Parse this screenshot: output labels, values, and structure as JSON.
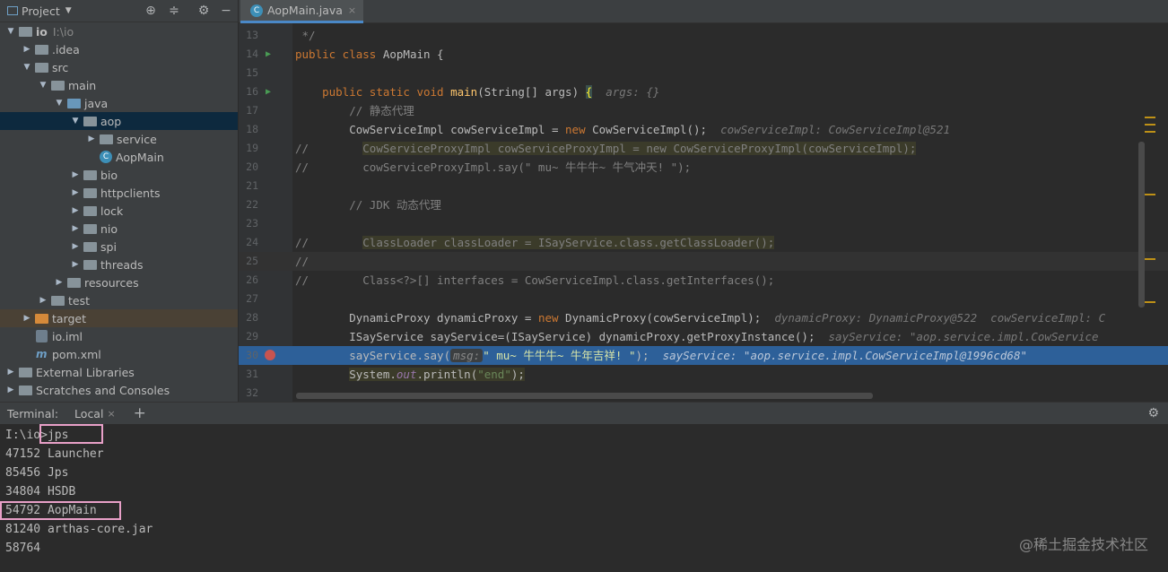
{
  "project_panel": {
    "title": "Project",
    "tree": [
      {
        "label": "io",
        "extra": "I:\\io",
        "depth": 0,
        "arrow": "▼",
        "icon": "module"
      },
      {
        "label": ".idea",
        "depth": 1,
        "arrow": "▶",
        "icon": "folder"
      },
      {
        "label": "src",
        "depth": 1,
        "arrow": "▼",
        "icon": "folder"
      },
      {
        "label": "main",
        "depth": 2,
        "arrow": "▼",
        "icon": "folder"
      },
      {
        "label": "java",
        "depth": 3,
        "arrow": "▼",
        "icon": "folder-blue"
      },
      {
        "label": "aop",
        "depth": 4,
        "arrow": "▼",
        "icon": "package",
        "selected": true
      },
      {
        "label": "service",
        "depth": 5,
        "arrow": "▶",
        "icon": "package"
      },
      {
        "label": "AopMain",
        "depth": 5,
        "arrow": "",
        "icon": "class"
      },
      {
        "label": "bio",
        "depth": 4,
        "arrow": "▶",
        "icon": "package"
      },
      {
        "label": "httpclients",
        "depth": 4,
        "arrow": "▶",
        "icon": "package"
      },
      {
        "label": "lock",
        "depth": 4,
        "arrow": "▶",
        "icon": "package"
      },
      {
        "label": "nio",
        "depth": 4,
        "arrow": "▶",
        "icon": "package"
      },
      {
        "label": "spi",
        "depth": 4,
        "arrow": "▶",
        "icon": "package"
      },
      {
        "label": "threads",
        "depth": 4,
        "arrow": "▶",
        "icon": "package"
      },
      {
        "label": "resources",
        "depth": 3,
        "arrow": "▶",
        "icon": "resources"
      },
      {
        "label": "test",
        "depth": 2,
        "arrow": "▶",
        "icon": "folder"
      },
      {
        "label": "target",
        "depth": 1,
        "arrow": "▶",
        "icon": "folder-orange",
        "excluded": true
      },
      {
        "label": "io.iml",
        "depth": 1,
        "arrow": "",
        "icon": "iml"
      },
      {
        "label": "pom.xml",
        "depth": 1,
        "arrow": "",
        "icon": "maven"
      },
      {
        "label": "External Libraries",
        "depth": 0,
        "arrow": "▶",
        "icon": "libraries"
      },
      {
        "label": "Scratches and Consoles",
        "depth": 0,
        "arrow": "▶",
        "icon": "scratches"
      }
    ]
  },
  "editor": {
    "tab_label": "AopMain.java",
    "lines": [
      {
        "n": "13",
        "html": "<span class='cm'> */</span>"
      },
      {
        "n": "14",
        "html": "<span class='kw'>public class</span> AopMain {",
        "run": true
      },
      {
        "n": "15",
        "html": ""
      },
      {
        "n": "16",
        "html": "    <span class='kw'>public static void</span> <span class='fn'>main</span>(String[] args) <span style='background:#3b514d;color:#ffef28'>{</span>  <span class='hint'>args: {}</span>",
        "run": true
      },
      {
        "n": "17",
        "html": "        <span class='cm'>// 静态代理</span>"
      },
      {
        "n": "18",
        "html": "        CowServiceImpl cowServiceImpl = <span class='kw'>new</span> CowServiceImpl();  <span class='hint'>cowServiceImpl: CowServiceImpl@521</span>"
      },
      {
        "n": "19",
        "html": "<span class='cm'>//        <span class='hl'>CowServiceProxyImpl cowServiceProxyImpl = new CowServiceProxyImpl(cowServiceImpl);</span></span>"
      },
      {
        "n": "20",
        "html": "<span class='cm'>//        cowServiceProxyImpl.say(\" mu~ 牛牛牛~ 牛气冲天! \");</span>"
      },
      {
        "n": "21",
        "html": ""
      },
      {
        "n": "22",
        "html": "        <span class='cm'>// JDK 动态代理</span>"
      },
      {
        "n": "23",
        "html": ""
      },
      {
        "n": "24",
        "html": "<span class='cm'>//        <span class='hl'>ClassLoader classLoader = ISayService.class.getClassLoader();</span></span>"
      },
      {
        "n": "25",
        "html": "<span class='cm'>//</span>",
        "current": true
      },
      {
        "n": "26",
        "html": "<span class='cm'>//        Class&lt;?&gt;[] interfaces = CowServiceImpl.class.getInterfaces();</span>"
      },
      {
        "n": "27",
        "html": ""
      },
      {
        "n": "28",
        "html": "        DynamicProxy dynamicProxy = <span class='kw'>new</span> DynamicProxy(cowServiceImpl);  <span class='hint'>dynamicProxy: DynamicProxy@522  cowServiceImpl: C</span>"
      },
      {
        "n": "29",
        "html": "        ISayService sayService=(ISayService) dynamicProxy.getProxyInstance();  <span class='hint'>sayService: \"aop.service.impl.CowService</span>"
      },
      {
        "n": "30",
        "html": "        sayService.say(<span class='hint-box'>msg:</span><span class='st' style='color:#d7e4a8'>\" mu~ 牛牛牛~ 牛年吉祥! \"</span>);  <span class='hint'>sayService: \"aop.service.impl.CowServiceImpl@1996cd68\"</span>",
        "exec": true,
        "bp": true
      },
      {
        "n": "31",
        "html": "        <span class='hl'>System.<span class='sc'>out</span>.println(<span class='st'>\"end\"</span>);</span>"
      },
      {
        "n": "32",
        "html": ""
      }
    ]
  },
  "terminal": {
    "label": "Terminal:",
    "tab": "Local",
    "lines": [
      "I:\\io>jps",
      "47152 Launcher",
      "85456 Jps",
      "34804 HSDB",
      "54792 AopMain",
      "81240 arthas-core.jar",
      "58764"
    ]
  },
  "watermark": "@稀土掘金技术社区",
  "colors": {
    "selection": "#0d293e",
    "exec_line": "#2d6099",
    "accent": "#4a88c7",
    "highlight_box": "#e8a0c8"
  }
}
